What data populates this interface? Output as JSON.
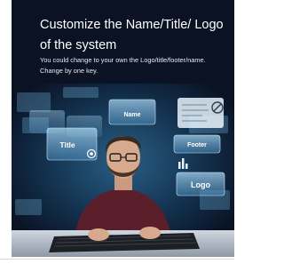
{
  "banner": {
    "title": "Customize the Name/Title/ Logo of the system",
    "description": "You could change to your own the Logo/title/footer/name. Change by one key.",
    "panel_labels": {
      "name": "Name",
      "title": "Title",
      "footer": "Footer",
      "logo": "Logo"
    }
  },
  "colors": {
    "background": "#0a1224",
    "panel_glow": "#5fa8d8",
    "text": "#ffffff"
  }
}
